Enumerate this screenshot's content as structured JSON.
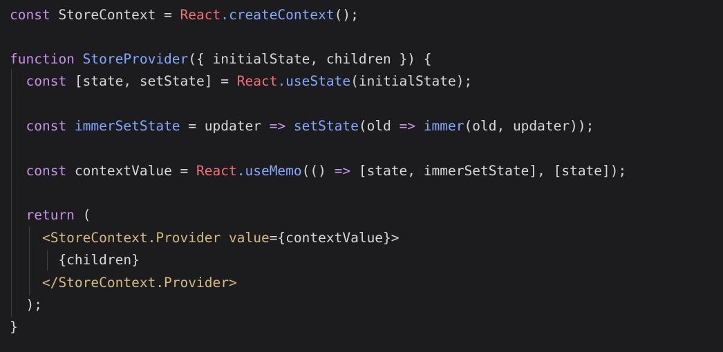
{
  "colors": {
    "background": "#1c1c1e",
    "keyword": "#c792ea",
    "function": "#82aaff",
    "react": "#f07178",
    "text": "#d8d8d8",
    "tag": "#d7ba7d"
  },
  "code": {
    "lines": [
      [
        {
          "t": "const",
          "c": "kw"
        },
        {
          "t": " StoreContext = ",
          "c": "plain"
        },
        {
          "t": "React",
          "c": "react"
        },
        {
          "t": ".createContext",
          "c": "fn"
        },
        {
          "t": "();",
          "c": "plain"
        }
      ],
      [],
      [
        {
          "t": "function",
          "c": "kw"
        },
        {
          "t": " StoreProvider",
          "c": "fn"
        },
        {
          "t": "({ initialState, children }) {",
          "c": "plain"
        }
      ],
      [
        {
          "t": "  const",
          "c": "kw"
        },
        {
          "t": " [state, setState] = ",
          "c": "plain"
        },
        {
          "t": "React",
          "c": "react"
        },
        {
          "t": ".useState",
          "c": "fn"
        },
        {
          "t": "(initialState);",
          "c": "plain"
        }
      ],
      [],
      [
        {
          "t": "  const",
          "c": "kw"
        },
        {
          "t": " immerSetState",
          "c": "fn"
        },
        {
          "t": " = updater ",
          "c": "plain"
        },
        {
          "t": "=>",
          "c": "kw"
        },
        {
          "t": " setState",
          "c": "fn"
        },
        {
          "t": "(old ",
          "c": "plain"
        },
        {
          "t": "=>",
          "c": "kw"
        },
        {
          "t": " immer",
          "c": "fn"
        },
        {
          "t": "(old, updater));",
          "c": "plain"
        }
      ],
      [],
      [
        {
          "t": "  const",
          "c": "kw"
        },
        {
          "t": " contextValue = ",
          "c": "plain"
        },
        {
          "t": "React",
          "c": "react"
        },
        {
          "t": ".useMemo",
          "c": "fn"
        },
        {
          "t": "(() ",
          "c": "plain"
        },
        {
          "t": "=>",
          "c": "kw"
        },
        {
          "t": " [state, immerSetState], [state]);",
          "c": "plain"
        }
      ],
      [],
      [
        {
          "t": "  return",
          "c": "kw"
        },
        {
          "t": " (",
          "c": "plain"
        }
      ],
      [
        {
          "t": "    <StoreContext.Provider ",
          "c": "tag"
        },
        {
          "t": "value",
          "c": "tag"
        },
        {
          "t": "={contextValue}>",
          "c": "plain"
        }
      ],
      [
        {
          "t": "      {children}",
          "c": "plain"
        }
      ],
      [
        {
          "t": "    </StoreContext.Provider>",
          "c": "tag"
        }
      ],
      [
        {
          "t": "  );",
          "c": "plain"
        }
      ],
      [
        {
          "t": "}",
          "c": "plain"
        }
      ]
    ]
  }
}
